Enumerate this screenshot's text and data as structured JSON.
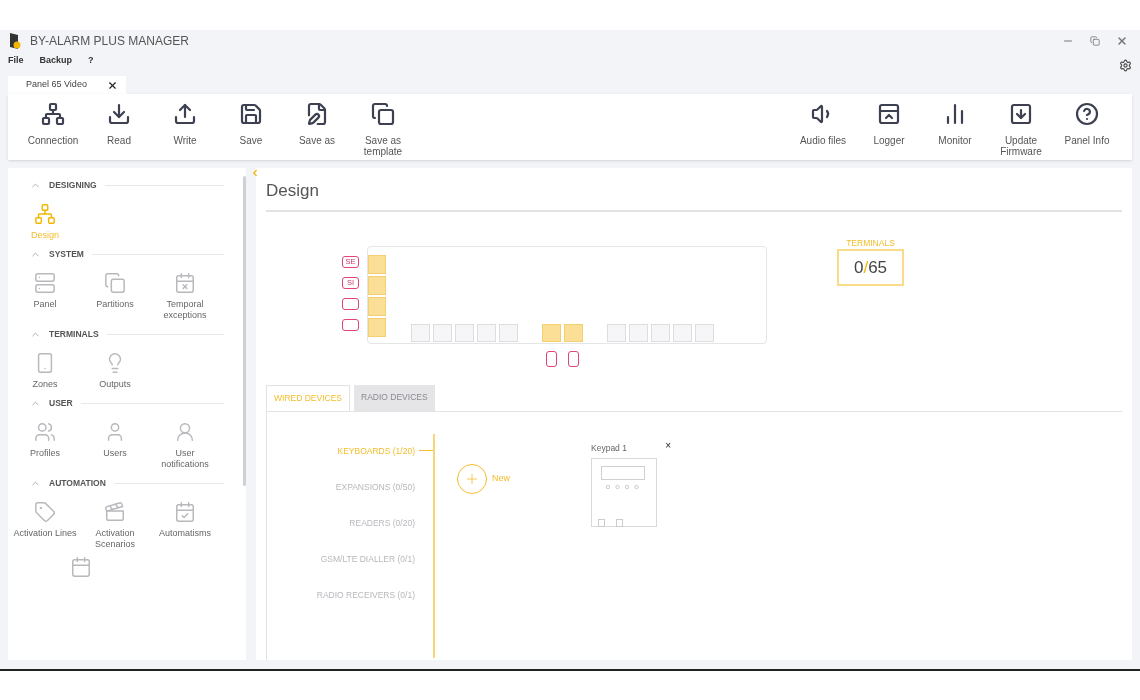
{
  "window": {
    "title": "BY-ALARM PLUS MANAGER"
  },
  "menu": [
    "File",
    "Backup",
    "?"
  ],
  "document_tabs": [
    {
      "label": "Panel 65 Video",
      "selected": true
    }
  ],
  "toolbar_left": [
    {
      "label": "Connection"
    },
    {
      "label": "Read"
    },
    {
      "label": "Write"
    },
    {
      "label": "Save"
    },
    {
      "label": "Save as"
    },
    {
      "label": "Save as template"
    }
  ],
  "toolbar_right": [
    {
      "label": "Audio files"
    },
    {
      "label": "Logger"
    },
    {
      "label": "Monitor"
    },
    {
      "label": "Update Firmware"
    },
    {
      "label": "Panel Info"
    }
  ],
  "sidebar": {
    "sections": [
      {
        "title": "DESIGNING",
        "items": [
          {
            "label": "Design",
            "selected": true
          }
        ]
      },
      {
        "title": "SYSTEM",
        "items": [
          {
            "label": "Panel",
            "selected": false
          },
          {
            "label": "Partitions",
            "selected": false
          },
          {
            "label": "Temporal exceptions",
            "selected": false
          }
        ]
      },
      {
        "title": "TERMINALS",
        "items": [
          {
            "label": "Zones",
            "selected": false
          },
          {
            "label": "Outputs",
            "selected": false
          }
        ]
      },
      {
        "title": "USER",
        "items": [
          {
            "label": "Profiles",
            "selected": false
          },
          {
            "label": "Users",
            "selected": false
          },
          {
            "label": "User notifications",
            "selected": false
          }
        ]
      },
      {
        "title": "AUTOMATION",
        "items": [
          {
            "label": "Activation Lines",
            "selected": false
          },
          {
            "label": "Activation Scenarios",
            "selected": false
          },
          {
            "label": "Automatisms",
            "selected": false
          }
        ]
      }
    ]
  },
  "page": {
    "title": "Design"
  },
  "board": {
    "left_ports": [
      {
        "label": "SE",
        "occupied": true
      },
      {
        "label": "SI",
        "occupied": true
      },
      {
        "occupied": true
      },
      {
        "occupied": true
      }
    ],
    "bottom_slots": [
      {
        "occupied": false
      },
      {
        "occupied": false
      },
      {
        "occupied": false
      },
      {
        "occupied": false
      },
      {
        "occupied": false
      },
      {
        "occupied": true
      },
      {
        "occupied": true
      },
      {
        "occupied": false
      },
      {
        "occupied": false
      },
      {
        "occupied": false
      },
      {
        "occupied": false
      },
      {
        "occupied": false
      }
    ]
  },
  "terminals": {
    "label": "TERMINALS",
    "used": "0",
    "separator": "/",
    "total": "65"
  },
  "device_tabs": [
    {
      "label": "WIRED DEVICES",
      "selected": true
    },
    {
      "label": "RADIO DEVICES",
      "selected": false
    }
  ],
  "categories": [
    {
      "label": "KEYBOARDS (1/20)",
      "selected": true
    },
    {
      "label": "EXPANSIONS (0/50)",
      "selected": false
    },
    {
      "label": "READERS (0/20)",
      "selected": false
    },
    {
      "label": "GSM/LTE DIALLER (0/1)",
      "selected": false
    },
    {
      "label": "RADIO RECEIVERS (0/1)",
      "selected": false
    }
  ],
  "new_button": {
    "label": "New"
  },
  "devices": [
    {
      "name": "Keypad 1",
      "close": "×"
    }
  ]
}
